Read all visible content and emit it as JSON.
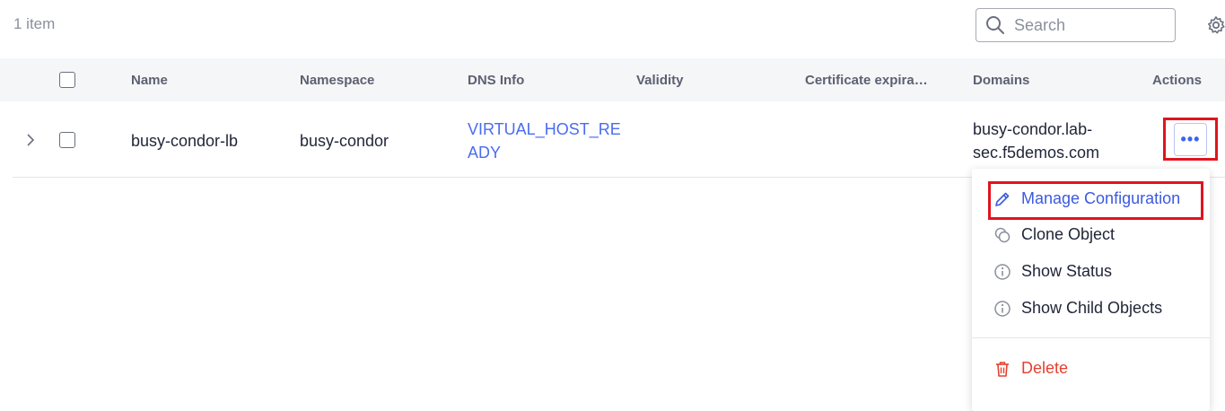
{
  "toolbar": {
    "item_count": "1 item",
    "search_placeholder": "Search",
    "search_icon": "search-icon",
    "settings_icon": "gear-icon"
  },
  "table": {
    "columns": [
      "Name",
      "Namespace",
      "DNS Info",
      "Validity",
      "Certificate expira…",
      "Domains",
      "Actions"
    ],
    "rows": [
      {
        "name": "busy-condor-lb",
        "namespace": "busy-condor",
        "dns_info_line1": "VIRTUAL_HOST_RE",
        "dns_info_line2": "ADY",
        "validity": "",
        "certificate_expiration": "",
        "domains_line1": "busy-condor.lab-",
        "domains_line2": "sec.f5demos.com",
        "actions_label": "•••"
      }
    ]
  },
  "actions_menu": {
    "items": [
      {
        "label": "Manage Configuration",
        "icon": "pencil-icon"
      },
      {
        "label": "Clone Object",
        "icon": "clone-icon"
      },
      {
        "label": "Show Status",
        "icon": "info-icon"
      },
      {
        "label": "Show Child Objects",
        "icon": "info-icon"
      },
      {
        "label": "Delete",
        "icon": "trash-icon"
      }
    ]
  },
  "colors": {
    "accent": "#3c5ae0",
    "link": "#4b6cf0",
    "danger": "#e5402f",
    "highlight": "#e0141e",
    "header_bg": "#f5f6f8"
  }
}
